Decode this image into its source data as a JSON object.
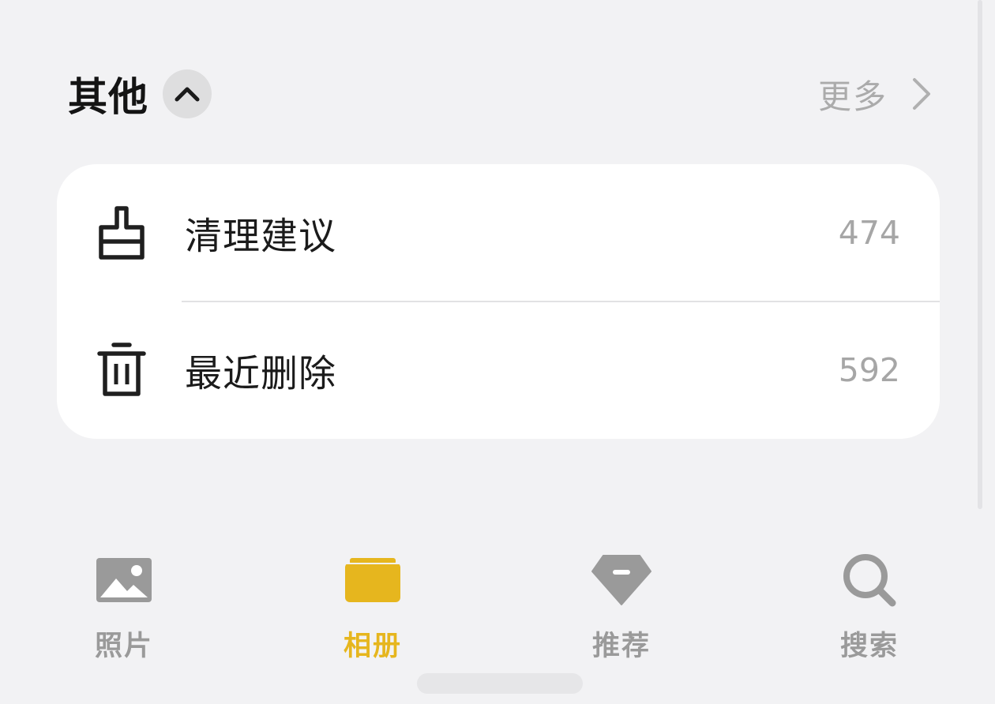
{
  "section": {
    "title": "其他",
    "more_label": "更多"
  },
  "list": {
    "items": [
      {
        "label": "清理建议",
        "count": "474",
        "icon": "broom-icon"
      },
      {
        "label": "最近删除",
        "count": "592",
        "icon": "trash-icon"
      }
    ]
  },
  "tabbar": {
    "tabs": [
      {
        "label": "照片",
        "icon": "photo-icon",
        "active": false
      },
      {
        "label": "相册",
        "icon": "album-icon",
        "active": true
      },
      {
        "label": "推荐",
        "icon": "recommend-icon",
        "active": false
      },
      {
        "label": "搜索",
        "icon": "search-icon",
        "active": false
      }
    ]
  },
  "colors": {
    "accent": "#e6b61e",
    "inactive_tab": "#9a9a9a",
    "background": "#f2f2f4",
    "card": "#ffffff"
  }
}
